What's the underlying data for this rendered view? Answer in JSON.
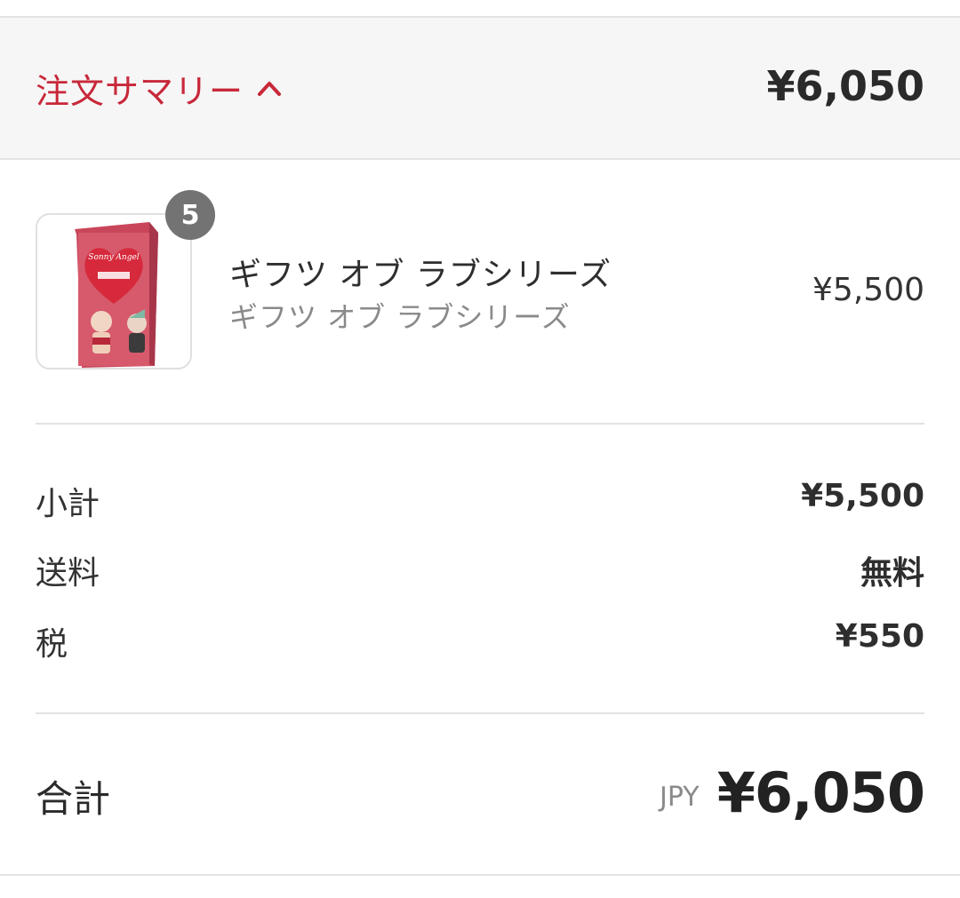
{
  "header": {
    "toggle_label": "注文サマリー",
    "total": "¥6,050"
  },
  "item": {
    "quantity": "5",
    "name": "ギフツ オブ ラブシリーズ",
    "variant": "ギフツ オブ ラブシリーズ",
    "price": "¥5,500"
  },
  "lines": [
    {
      "label": "小計",
      "value": "¥5,500"
    },
    {
      "label": "送料",
      "value": "無料"
    },
    {
      "label": "税",
      "value": "¥550"
    }
  ],
  "total": {
    "label": "合計",
    "currency": "JPY",
    "value": "¥6,050"
  },
  "colors": {
    "accent": "#c8283a",
    "badge": "#737373"
  }
}
